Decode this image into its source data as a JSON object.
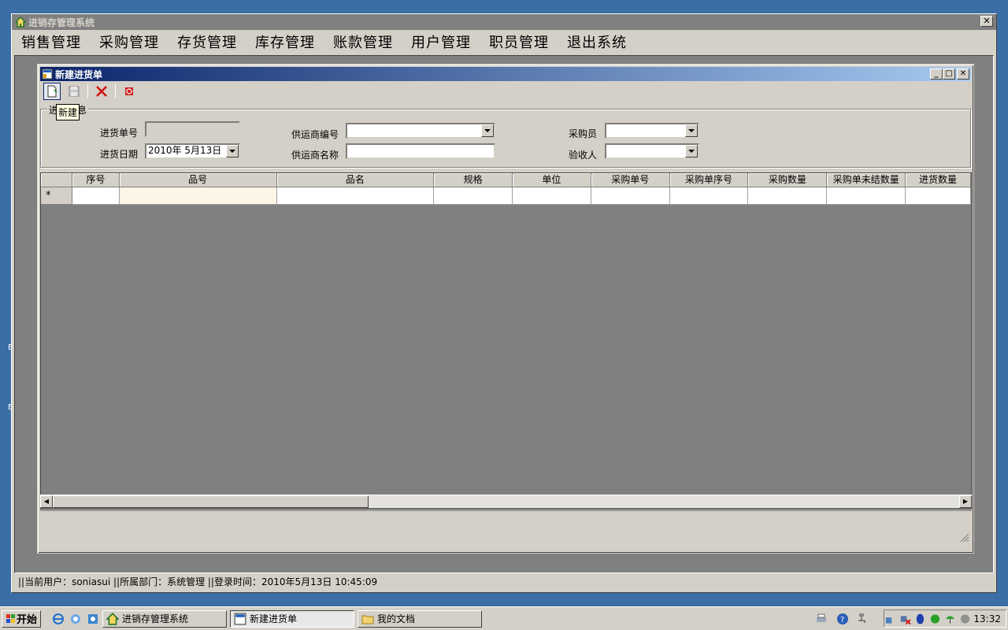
{
  "app": {
    "title": "进销存管理系统",
    "close": "✕"
  },
  "menu": [
    "销售管理",
    "采购管理",
    "存货管理",
    "库存管理",
    "账款管理",
    "用户管理",
    "职员管理",
    "退出系统"
  ],
  "child": {
    "title": "新建进货单",
    "tooltip": "新建"
  },
  "form": {
    "group_title": "进货信息",
    "purchase_no_label": "进货单号",
    "purchase_no_value": "",
    "date_label": "进货日期",
    "date_value": "2010年  5月13日",
    "supplier_no_label": "供运商编号",
    "supplier_no_value": "",
    "supplier_name_label": "供运商名称",
    "supplier_name_value": "",
    "buyer_label": "采购员",
    "buyer_value": "",
    "receiver_label": "验收人",
    "receiver_value": ""
  },
  "grid": {
    "columns": [
      "序号",
      "品号",
      "品名",
      "规格",
      "单位",
      "采购单号",
      "采购单序号",
      "采购数量",
      "采购单未结数量",
      "进货数量"
    ],
    "new_row_marker": "*"
  },
  "statusbar": {
    "text": "||当前用户：soniasui ||所属部门：系统管理 ||登录时间：2010年5月13日 10:45:09"
  },
  "taskbar": {
    "start": "开始",
    "tasks": [
      "进销存管理系统",
      "新建进货单",
      "我的文档"
    ],
    "clock": "13:32"
  }
}
